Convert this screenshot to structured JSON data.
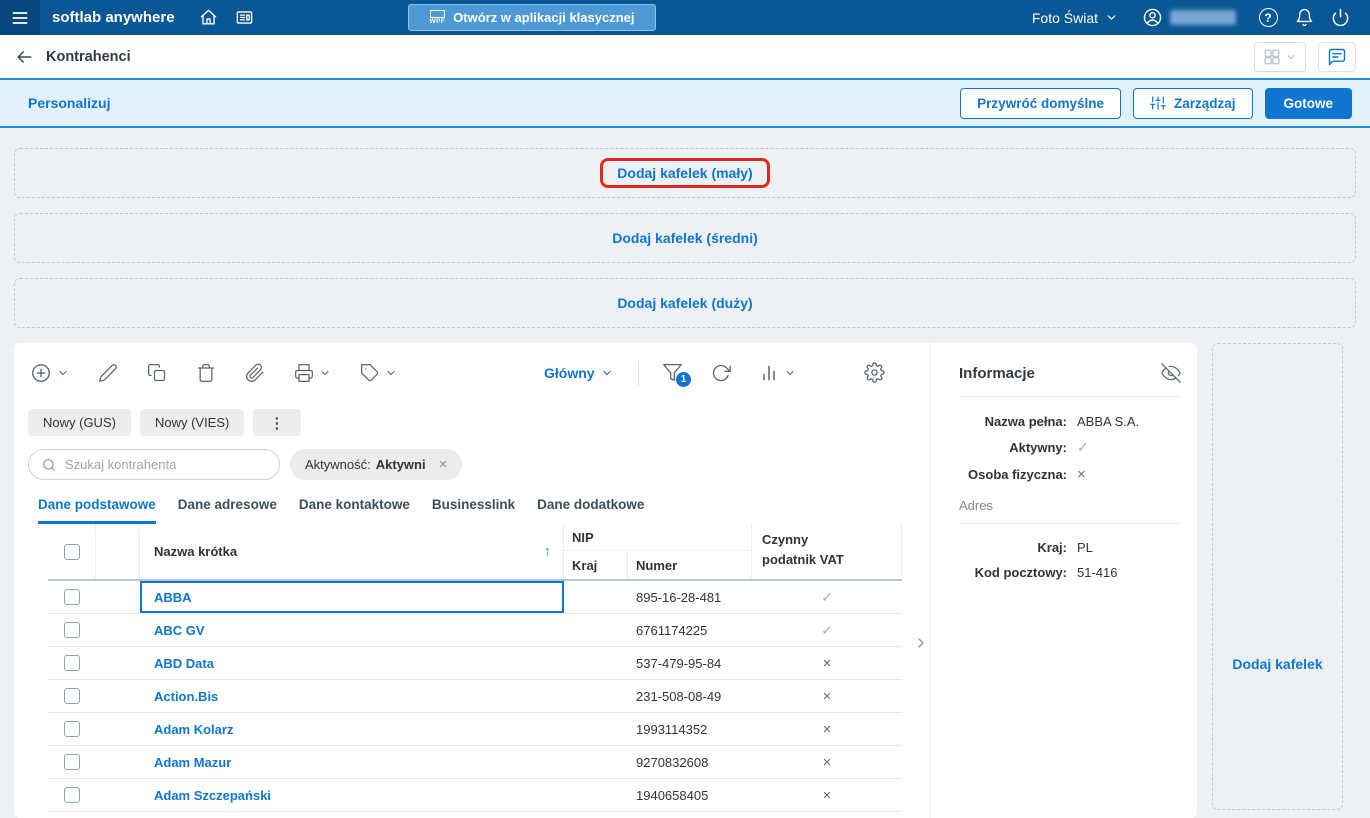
{
  "colors": {
    "topbar_bg": "#0a5795",
    "accent_blue": "#0e76d1",
    "personalize_bar_bg": "#e2f2fd",
    "personalize_bar_border": "#1f8fdc",
    "page_bg": "#edf1f6",
    "annotation_red": "#e02b20",
    "sort_green": "#2faf5a"
  },
  "icons": {
    "question": "?",
    "wpf": "WPF",
    "dots": "⋮",
    "close-x": "×",
    "sort-asc": "↑",
    "check": "✓",
    "cross": "×"
  },
  "topbar": {
    "brand": "softlab anywhere",
    "open_classic_label": "Otwórz w aplikacji klasycznej",
    "company": "Foto Świat"
  },
  "header": {
    "title": "Kontrahenci"
  },
  "personalize": {
    "title": "Personalizuj",
    "restore_label": "Przywróć domyślne",
    "manage_label": "Zarządzaj",
    "done_label": "Gotowe"
  },
  "tiles": {
    "small_label": "Dodaj kafelek (mały)",
    "medium_label": "Dodaj kafelek (średni)",
    "large_label": "Dodaj kafelek (duży)",
    "side_label": "Dodaj kafelek"
  },
  "grid": {
    "view_label": "Główny",
    "filter_count": "1",
    "new_gus_label": "Nowy (GUS)",
    "new_vies_label": "Nowy (VIES)",
    "search_placeholder": "Szukaj kontrahenta",
    "filter_chip_label": "Aktywność:",
    "filter_chip_value": "Aktywni",
    "tabs": [
      "Dane podstawowe",
      "Dane adresowe",
      "Dane kontaktowe",
      "Businesslink",
      "Dane dodatkowe"
    ],
    "active_tab": "Dane podstawowe",
    "columns": {
      "name": "Nazwa krótka",
      "nip": "NIP",
      "nip_country": "Kraj",
      "nip_number": "Numer",
      "vat_line1": "Czynny",
      "vat_line2": "podatnik VAT"
    },
    "rows": [
      {
        "name": "ABBA",
        "nip_number": "895-16-28-481",
        "vat_glyph": "✓",
        "vat_class": "cell-flag check",
        "selected": true
      },
      {
        "name": "ABC GV",
        "nip_number": "6761174225",
        "vat_glyph": "✓",
        "vat_class": "cell-flag check",
        "selected": false
      },
      {
        "name": "ABD Data",
        "nip_number": "537-479-95-84",
        "vat_glyph": "×",
        "vat_class": "cell-flag cross",
        "selected": false
      },
      {
        "name": "Action.Bis",
        "nip_number": "231-508-08-49",
        "vat_glyph": "×",
        "vat_class": "cell-flag cross",
        "selected": false
      },
      {
        "name": "Adam Kolarz",
        "nip_number": "1993114352",
        "vat_glyph": "×",
        "vat_class": "cell-flag cross",
        "selected": false
      },
      {
        "name": "Adam Mazur",
        "nip_number": "9270832608",
        "vat_glyph": "×",
        "vat_class": "cell-flag cross",
        "selected": false
      },
      {
        "name": "Adam Szczepański",
        "nip_number": "1940658405",
        "vat_glyph": "×",
        "vat_class": "cell-flag cross",
        "selected": false
      }
    ]
  },
  "info": {
    "title": "Informacje",
    "fields": [
      {
        "label": "Nazwa pełna:",
        "value": "ABBA S.A.",
        "class": "ival"
      },
      {
        "label": "Aktywny:",
        "value": "✓",
        "class": "ival check"
      },
      {
        "label": "Osoba fizyczna:",
        "value": "×",
        "class": "ival cross"
      }
    ],
    "section_label": "Adres",
    "address_fields": [
      {
        "label": "Kraj:",
        "value": "PL"
      },
      {
        "label": "Kod pocztowy:",
        "value": "51-416"
      }
    ]
  }
}
